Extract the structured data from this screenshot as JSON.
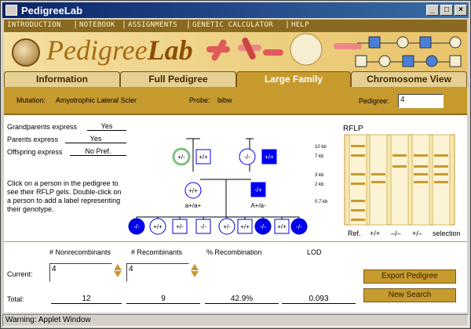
{
  "window": {
    "title": "PedigreeLab"
  },
  "menu": [
    {
      "label": "INTRODUCTION"
    },
    {
      "label": "NOTEBOOK"
    },
    {
      "label": "ASSIGNMENTS"
    },
    {
      "label": "GENETIC CALCULATOR"
    },
    {
      "label": "HELP"
    }
  ],
  "logo": {
    "part1": "Pedigree",
    "part2": "Lab"
  },
  "tabs": [
    {
      "label": "Information"
    },
    {
      "label": "Full Pedigree"
    },
    {
      "label": "Large Family"
    },
    {
      "label": "Chromosome View"
    }
  ],
  "mutation": {
    "label": "Mutation:",
    "value": "Amyotrophic Lateral Scler",
    "probe_label": "Probe:",
    "probe_value": "bibw",
    "pedigree_label": "Pedigree:",
    "pedigree_value": "4"
  },
  "expression": {
    "grandparents_label": "Grandparents express",
    "grandparents_value": "Yes",
    "parents_label": "Parents express",
    "parents_value": "Yes",
    "offspring_label": "Offspring express",
    "offspring_value": "No Pref."
  },
  "instructions": "Click on a person in the pedigree to see their RFLP gels.  Double-click on a person to add a label representing their genotype.",
  "pedigree": {
    "grandparents": [
      "+/-",
      "+/+",
      "-/-",
      "+/+"
    ],
    "parents": [
      "+/+",
      "-/+"
    ],
    "parent_genotypes": [
      "a+/a+",
      "A+/a-"
    ],
    "offspring": [
      "-/-",
      "+/+",
      "+/-",
      "-/-",
      "+/-",
      "+/+",
      "-/-",
      "+/+",
      "-/-",
      "-/+"
    ]
  },
  "rflp": {
    "title": "RFLP",
    "sizes": [
      "10 kb",
      "7 kb",
      "3 kb",
      "2 kb",
      "0.7 kb"
    ],
    "lanes": [
      "Ref.",
      "+/+",
      "–/–",
      "+/–",
      "selection"
    ]
  },
  "stats": {
    "nonrecomb_label": "# Nonrecombinants",
    "recomb_label": "# Recombinants",
    "percent_label": "% Recombination",
    "lod_label": "LOD",
    "current_label": "Current:",
    "current_nonrecomb": "4",
    "current_recomb": "4",
    "total_label": "Total:",
    "total_nonrecomb": "12",
    "total_recomb": "9",
    "total_percent": "42.9%",
    "total_lod": "0.093"
  },
  "buttons": {
    "export": "Export Pedigree",
    "new_search": "New Search"
  },
  "status": "Warning: Applet Window",
  "colors": {
    "gold": "#c79a2e",
    "blue": "#0000cc",
    "affected_fill": "#0000ee"
  }
}
